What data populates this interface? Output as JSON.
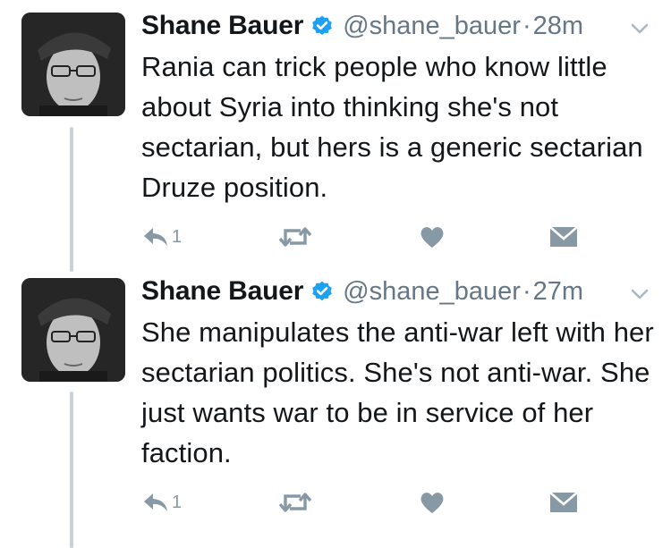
{
  "tweets": [
    {
      "name": "Shane Bauer",
      "handle": "@shane_bauer",
      "separator": "·",
      "time": "28m",
      "text": "Rania can trick people who know little about Syria into thinking she's not sectarian, but hers is a generic sectarian Druze position.",
      "reply_count": "1"
    },
    {
      "name": "Shane Bauer",
      "handle": "@shane_bauer",
      "separator": "·",
      "time": "27m",
      "text": "She manipulates the anti-war left with her sectarian politics. She's not anti-war. She just wants war to be in service of her faction.",
      "reply_count": "1"
    }
  ],
  "icons": [
    "avatar",
    "verified-badge-icon",
    "chevron-down-icon",
    "reply-icon",
    "retweet-icon",
    "like-icon",
    "direct-message-icon"
  ],
  "colors": {
    "text": "#14171a",
    "secondary": "#657786",
    "action": "#8899a6",
    "verified": "#1da1f2",
    "thread_line": "#c7d2da"
  }
}
